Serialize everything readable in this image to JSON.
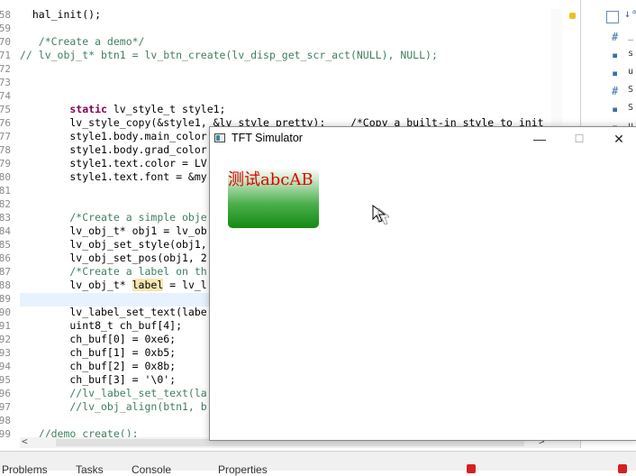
{
  "editor": {
    "lines": [
      {
        "n": "58",
        "text": "hal_init();",
        "indent": "  ",
        "cls": ""
      },
      {
        "n": "59",
        "text": "",
        "indent": "",
        "cls": ""
      },
      {
        "n": "70",
        "text": "/*Create a demo*/",
        "indent": "   ",
        "cls": "cm"
      },
      {
        "n": "71",
        "text": "// lv_obj_t* btn1 = lv_btn_create(lv_disp_get_scr_act(NULL), NULL);",
        "indent": "",
        "cls": "cm"
      },
      {
        "n": "72",
        "text": "",
        "indent": "",
        "cls": ""
      },
      {
        "n": "73",
        "text": "",
        "indent": "",
        "cls": ""
      },
      {
        "n": "74",
        "text": "",
        "indent": "",
        "cls": ""
      },
      {
        "n": "75",
        "text": "static lv_style_t style1;",
        "indent": "        ",
        "cls": "kwline"
      },
      {
        "n": "76",
        "text": "lv_style_copy(&style1, &lv_style_pretty);    /*Copy a built-in style to init",
        "indent": "        ",
        "cls": ""
      },
      {
        "n": "77",
        "text": "style1.body.main_color",
        "indent": "        ",
        "cls": ""
      },
      {
        "n": "78",
        "text": "style1.body.grad_color",
        "indent": "        ",
        "cls": ""
      },
      {
        "n": "79",
        "text": "style1.text.color = LV",
        "indent": "        ",
        "cls": ""
      },
      {
        "n": "80",
        "text": "style1.text.font = &my",
        "indent": "        ",
        "cls": ""
      },
      {
        "n": "81",
        "text": "",
        "indent": "",
        "cls": ""
      },
      {
        "n": "82",
        "text": "",
        "indent": "",
        "cls": ""
      },
      {
        "n": "83",
        "text": "/*Create a simple obje",
        "indent": "        ",
        "cls": "cm"
      },
      {
        "n": "84",
        "text": "lv_obj_t* obj1 = lv_ob",
        "indent": "        ",
        "cls": ""
      },
      {
        "n": "85",
        "text": "lv_obj_set_style(obj1,",
        "indent": "        ",
        "cls": ""
      },
      {
        "n": "86",
        "text": "lv_obj_set_pos(obj1, 2",
        "indent": "        ",
        "cls": ""
      },
      {
        "n": "87",
        "text": "/*Create a label on th",
        "indent": "        ",
        "cls": "cm"
      },
      {
        "n": "88",
        "text": "lv_obj_t* label = lv_l",
        "indent": "        ",
        "cls": "label"
      },
      {
        "n": "89",
        "text": "",
        "indent": "",
        "cls": ""
      },
      {
        "n": "90",
        "text": "lv_label_set_text(labe",
        "indent": "        ",
        "cls": ""
      },
      {
        "n": "91",
        "text": "uint8_t ch_buf[4];",
        "indent": "        ",
        "cls": ""
      },
      {
        "n": "92",
        "text": "ch_buf[0] = 0xe6;",
        "indent": "        ",
        "cls": ""
      },
      {
        "n": "93",
        "text": "ch_buf[1] = 0xb5;",
        "indent": "        ",
        "cls": ""
      },
      {
        "n": "94",
        "text": "ch_buf[2] = 0x8b;",
        "indent": "        ",
        "cls": ""
      },
      {
        "n": "95",
        "text": "ch_buf[3] = '\\0';",
        "indent": "        ",
        "cls": ""
      },
      {
        "n": "96",
        "text": "//lv_label_set_text(la",
        "indent": "        ",
        "cls": "cm"
      },
      {
        "n": "97",
        "text": "//lv_obj_align(btn1, b",
        "indent": "        ",
        "cls": "cm"
      },
      {
        "n": "98",
        "text": "",
        "indent": "",
        "cls": ""
      },
      {
        "n": "99",
        "text": "//demo_create();",
        "indent": "   ",
        "cls": "cm"
      }
    ]
  },
  "sidepanel": {
    "items": [
      "_",
      "s",
      "u",
      "S",
      "S",
      "u"
    ]
  },
  "bottom_tabs": [
    "Problems",
    "Tasks",
    "Console",
    "Properties"
  ],
  "simulator": {
    "title": "TFT Simulator",
    "minimize": "—",
    "maximize": "☐",
    "close": "✕",
    "label_text": "测试abcAB"
  },
  "colors": {
    "label": "#e00000",
    "button_dark": "#138a13",
    "comment": "#3f7f5f"
  }
}
